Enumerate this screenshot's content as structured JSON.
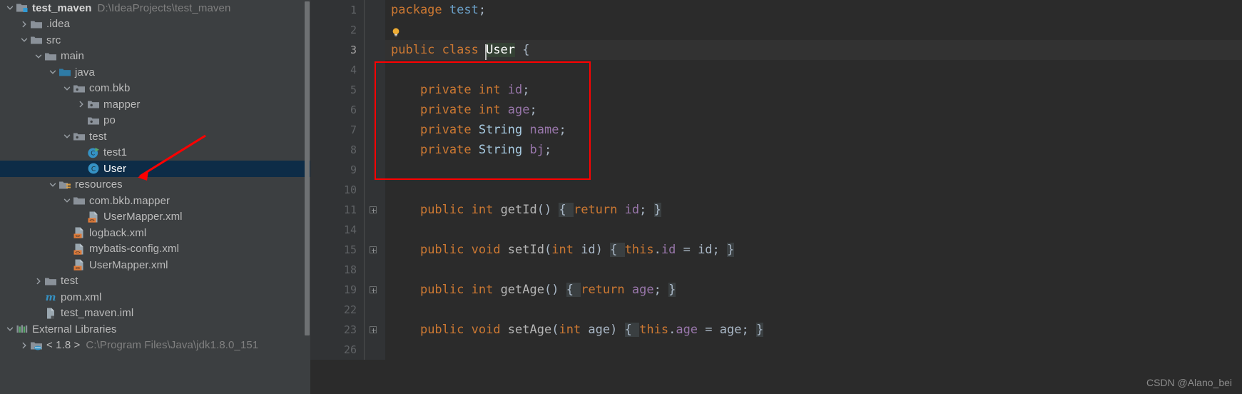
{
  "project_tree": {
    "items": [
      {
        "label": "test_maven",
        "sublabel": "D:\\IdeaProjects\\test_maven",
        "indent": 0,
        "twisty": "down",
        "icon": "project-module-icon",
        "bold": true,
        "selected": false
      },
      {
        "label": ".idea",
        "sublabel": "",
        "indent": 1,
        "twisty": "right",
        "icon": "folder-icon",
        "bold": false,
        "selected": false
      },
      {
        "label": "src",
        "sublabel": "",
        "indent": 1,
        "twisty": "down",
        "icon": "folder-icon",
        "bold": false,
        "selected": false
      },
      {
        "label": "main",
        "sublabel": "",
        "indent": 2,
        "twisty": "down",
        "icon": "folder-icon",
        "bold": false,
        "selected": false
      },
      {
        "label": "java",
        "sublabel": "",
        "indent": 3,
        "twisty": "down",
        "icon": "source-root-folder-icon",
        "bold": false,
        "selected": false
      },
      {
        "label": "com.bkb",
        "sublabel": "",
        "indent": 4,
        "twisty": "down",
        "icon": "package-icon",
        "bold": false,
        "selected": false
      },
      {
        "label": "mapper",
        "sublabel": "",
        "indent": 5,
        "twisty": "right",
        "icon": "package-icon",
        "bold": false,
        "selected": false
      },
      {
        "label": "po",
        "sublabel": "",
        "indent": 5,
        "twisty": "none",
        "icon": "package-icon",
        "bold": false,
        "selected": false
      },
      {
        "label": "test",
        "sublabel": "",
        "indent": 4,
        "twisty": "down",
        "icon": "package-icon",
        "bold": false,
        "selected": false
      },
      {
        "label": "test1",
        "sublabel": "",
        "indent": 5,
        "twisty": "none",
        "icon": "java-class-runnable-icon",
        "bold": false,
        "selected": false
      },
      {
        "label": "User",
        "sublabel": "",
        "indent": 5,
        "twisty": "none",
        "icon": "java-class-icon",
        "bold": false,
        "selected": true
      },
      {
        "label": "resources",
        "sublabel": "",
        "indent": 3,
        "twisty": "down",
        "icon": "resource-root-folder-icon",
        "bold": false,
        "selected": false
      },
      {
        "label": "com.bkb.mapper",
        "sublabel": "",
        "indent": 4,
        "twisty": "down",
        "icon": "folder-icon",
        "bold": false,
        "selected": false
      },
      {
        "label": "UserMapper.xml",
        "sublabel": "",
        "indent": 5,
        "twisty": "none",
        "icon": "xml-file-icon",
        "bold": false,
        "selected": false
      },
      {
        "label": "logback.xml",
        "sublabel": "",
        "indent": 4,
        "twisty": "none",
        "icon": "xml-file-icon",
        "bold": false,
        "selected": false
      },
      {
        "label": "mybatis-config.xml",
        "sublabel": "",
        "indent": 4,
        "twisty": "none",
        "icon": "xml-file-icon",
        "bold": false,
        "selected": false
      },
      {
        "label": "UserMapper.xml",
        "sublabel": "",
        "indent": 4,
        "twisty": "none",
        "icon": "xml-file-icon",
        "bold": false,
        "selected": false
      },
      {
        "label": "test",
        "sublabel": "",
        "indent": 2,
        "twisty": "right",
        "icon": "folder-icon",
        "bold": false,
        "selected": false
      },
      {
        "label": "pom.xml",
        "sublabel": "",
        "indent": 2,
        "twisty": "none",
        "icon": "maven-pom-icon",
        "bold": false,
        "selected": false
      },
      {
        "label": "test_maven.iml",
        "sublabel": "",
        "indent": 2,
        "twisty": "none",
        "icon": "iml-module-file-icon",
        "bold": false,
        "selected": false
      },
      {
        "label": "External Libraries",
        "sublabel": "",
        "indent": 0,
        "twisty": "down",
        "icon": "external-libraries-icon",
        "bold": false,
        "selected": false
      },
      {
        "label": "< 1.8 >",
        "sublabel": "C:\\Program Files\\Java\\jdk1.8.0_151",
        "indent": 1,
        "twisty": "right",
        "icon": "jdk-folder-icon",
        "bold": false,
        "selected": false
      }
    ]
  },
  "editor": {
    "lines": [
      {
        "num": "1",
        "fold": false,
        "current": false,
        "bulb": false,
        "tokens": [
          {
            "t": "package ",
            "c": "kw"
          },
          {
            "t": "test",
            "c": "pkg"
          },
          {
            "t": ";",
            "c": "pnc"
          }
        ],
        "indent": 0
      },
      {
        "num": "2",
        "fold": false,
        "current": false,
        "bulb": true,
        "tokens": [],
        "indent": 0
      },
      {
        "num": "3",
        "fold": false,
        "current": true,
        "bulb": false,
        "tokens": [
          {
            "t": "public ",
            "c": "kw"
          },
          {
            "t": "class ",
            "c": "kw"
          },
          {
            "t": "User",
            "c": "caret-sel"
          },
          {
            "t": " {",
            "c": "pnc"
          }
        ],
        "indent": 0
      },
      {
        "num": "4",
        "fold": false,
        "current": false,
        "bulb": false,
        "tokens": [],
        "indent": 0
      },
      {
        "num": "5",
        "fold": false,
        "current": false,
        "bulb": false,
        "tokens": [
          {
            "t": "private ",
            "c": "kw"
          },
          {
            "t": "int ",
            "c": "kw"
          },
          {
            "t": "id",
            "c": "fld"
          },
          {
            "t": ";",
            "c": "pnc"
          }
        ],
        "indent": 1
      },
      {
        "num": "6",
        "fold": false,
        "current": false,
        "bulb": false,
        "tokens": [
          {
            "t": "private ",
            "c": "kw"
          },
          {
            "t": "int ",
            "c": "kw"
          },
          {
            "t": "age",
            "c": "fld"
          },
          {
            "t": ";",
            "c": "pnc"
          }
        ],
        "indent": 1
      },
      {
        "num": "7",
        "fold": false,
        "current": false,
        "bulb": false,
        "tokens": [
          {
            "t": "private ",
            "c": "kw"
          },
          {
            "t": "String ",
            "c": "cls"
          },
          {
            "t": "name",
            "c": "fld"
          },
          {
            "t": ";",
            "c": "pnc"
          }
        ],
        "indent": 1
      },
      {
        "num": "8",
        "fold": false,
        "current": false,
        "bulb": false,
        "tokens": [
          {
            "t": "private ",
            "c": "kw"
          },
          {
            "t": "String ",
            "c": "cls"
          },
          {
            "t": "bj",
            "c": "fld"
          },
          {
            "t": ";",
            "c": "pnc"
          }
        ],
        "indent": 1
      },
      {
        "num": "9",
        "fold": false,
        "current": false,
        "bulb": false,
        "tokens": [],
        "indent": 0
      },
      {
        "num": "10",
        "fold": false,
        "current": false,
        "bulb": false,
        "tokens": [],
        "indent": 0
      },
      {
        "num": "11",
        "fold": true,
        "current": false,
        "bulb": false,
        "tokens": [
          {
            "t": "public ",
            "c": "kw"
          },
          {
            "t": "int ",
            "c": "kw"
          },
          {
            "t": "getId",
            "c": "mth"
          },
          {
            "t": "()",
            "c": "pnc"
          },
          {
            "t": " ",
            "c": "pnc"
          },
          {
            "t": "{ ",
            "c": "fold-brace"
          },
          {
            "t": "return ",
            "c": "kw"
          },
          {
            "t": "id",
            "c": "fld"
          },
          {
            "t": ";",
            "c": "pnc"
          },
          {
            "t": " ",
            "c": "pnc"
          },
          {
            "t": "}",
            "c": "fold-brace"
          }
        ],
        "indent": 1
      },
      {
        "num": "14",
        "fold": false,
        "current": false,
        "bulb": false,
        "tokens": [],
        "indent": 0
      },
      {
        "num": "15",
        "fold": true,
        "current": false,
        "bulb": false,
        "tokens": [
          {
            "t": "public ",
            "c": "kw"
          },
          {
            "t": "void ",
            "c": "kw"
          },
          {
            "t": "setId",
            "c": "mth"
          },
          {
            "t": "(",
            "c": "pnc"
          },
          {
            "t": "int ",
            "c": "kw"
          },
          {
            "t": "id",
            "c": "typ"
          },
          {
            "t": ")",
            "c": "pnc"
          },
          {
            "t": " ",
            "c": "pnc"
          },
          {
            "t": "{ ",
            "c": "fold-brace"
          },
          {
            "t": "this",
            "c": "kw"
          },
          {
            "t": ".",
            "c": "pnc"
          },
          {
            "t": "id",
            "c": "fld"
          },
          {
            "t": " = ",
            "c": "pnc"
          },
          {
            "t": "id",
            "c": "typ"
          },
          {
            "t": ";",
            "c": "pnc"
          },
          {
            "t": " ",
            "c": "pnc"
          },
          {
            "t": "}",
            "c": "fold-brace"
          }
        ],
        "indent": 1
      },
      {
        "num": "18",
        "fold": false,
        "current": false,
        "bulb": false,
        "tokens": [],
        "indent": 0
      },
      {
        "num": "19",
        "fold": true,
        "current": false,
        "bulb": false,
        "tokens": [
          {
            "t": "public ",
            "c": "kw"
          },
          {
            "t": "int ",
            "c": "kw"
          },
          {
            "t": "getAge",
            "c": "mth"
          },
          {
            "t": "()",
            "c": "pnc"
          },
          {
            "t": " ",
            "c": "pnc"
          },
          {
            "t": "{ ",
            "c": "fold-brace"
          },
          {
            "t": "return ",
            "c": "kw"
          },
          {
            "t": "age",
            "c": "fld"
          },
          {
            "t": ";",
            "c": "pnc"
          },
          {
            "t": " ",
            "c": "pnc"
          },
          {
            "t": "}",
            "c": "fold-brace"
          }
        ],
        "indent": 1
      },
      {
        "num": "22",
        "fold": false,
        "current": false,
        "bulb": false,
        "tokens": [],
        "indent": 0
      },
      {
        "num": "23",
        "fold": true,
        "current": false,
        "bulb": false,
        "tokens": [
          {
            "t": "public ",
            "c": "kw"
          },
          {
            "t": "void ",
            "c": "kw"
          },
          {
            "t": "setAge",
            "c": "mth"
          },
          {
            "t": "(",
            "c": "pnc"
          },
          {
            "t": "int ",
            "c": "kw"
          },
          {
            "t": "age",
            "c": "typ"
          },
          {
            "t": ")",
            "c": "pnc"
          },
          {
            "t": " ",
            "c": "pnc"
          },
          {
            "t": "{ ",
            "c": "fold-brace"
          },
          {
            "t": "this",
            "c": "kw"
          },
          {
            "t": ".",
            "c": "pnc"
          },
          {
            "t": "age",
            "c": "fld"
          },
          {
            "t": " = ",
            "c": "pnc"
          },
          {
            "t": "age",
            "c": "typ"
          },
          {
            "t": ";",
            "c": "pnc"
          },
          {
            "t": " ",
            "c": "pnc"
          },
          {
            "t": "}",
            "c": "fold-brace"
          }
        ],
        "indent": 1
      },
      {
        "num": "26",
        "fold": false,
        "current": false,
        "bulb": false,
        "tokens": [],
        "indent": 0
      }
    ]
  },
  "annotations": {
    "red_box_label": "fields-highlight-box",
    "red_arrow_label": "pointer-arrow-to-user-class",
    "color": "#ff0000"
  },
  "watermark": {
    "text": "CSDN @Alano_bei"
  }
}
